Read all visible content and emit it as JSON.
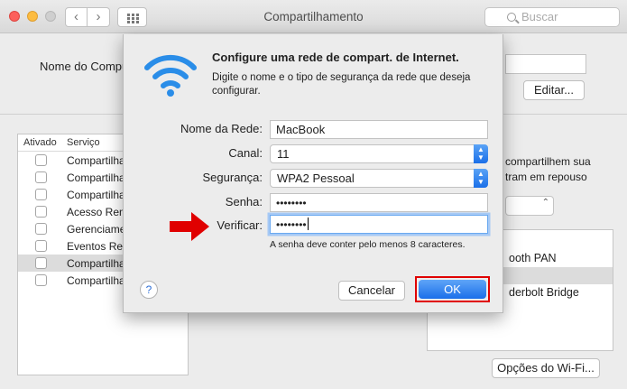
{
  "window": {
    "title": "Compartilhamento",
    "search_placeholder": "Buscar"
  },
  "background": {
    "computer_name_label": "Nome do Compu",
    "edit_button": "Editar...",
    "list_header": {
      "enabled": "Ativado",
      "service": "Serviço"
    },
    "services": [
      {
        "label": "Compartilha",
        "checked": false
      },
      {
        "label": "Compartilha",
        "checked": false
      },
      {
        "label": "Compartilha",
        "checked": false
      },
      {
        "label": "Acesso Rem",
        "checked": false
      },
      {
        "label": "Gerenciame",
        "checked": false
      },
      {
        "label": "Eventos Rem",
        "checked": false
      },
      {
        "label": "Compartilha",
        "checked": false,
        "selected": true
      },
      {
        "label": "Compartilha",
        "checked": false
      }
    ],
    "right_text_1": "compartilhem sua",
    "right_text_2": "tram em repouso",
    "ports": [
      "ooth PAN",
      "",
      "derbolt Bridge"
    ],
    "wifi_options_button": "Opções do Wi-Fi..."
  },
  "sheet": {
    "title": "Configure uma rede de compart. de Internet.",
    "description": "Digite o nome e o tipo de segurança da rede que deseja configurar.",
    "network_name": {
      "label": "Nome da Rede:",
      "value": "MacBook"
    },
    "channel": {
      "label": "Canal:",
      "value": "11"
    },
    "security": {
      "label": "Segurança:",
      "value": "WPA2 Pessoal"
    },
    "password": {
      "label": "Senha:",
      "value": "••••••••"
    },
    "verify": {
      "label": "Verificar:",
      "value": "••••••••"
    },
    "hint": "A senha deve conter pelo menos 8 caracteres.",
    "help": "?",
    "cancel_button": "Cancelar",
    "ok_button": "OK"
  },
  "colors": {
    "accent_blue": "#1b6fea",
    "annotation_red": "#e00000",
    "wifi_icon": "#2a8de8"
  }
}
